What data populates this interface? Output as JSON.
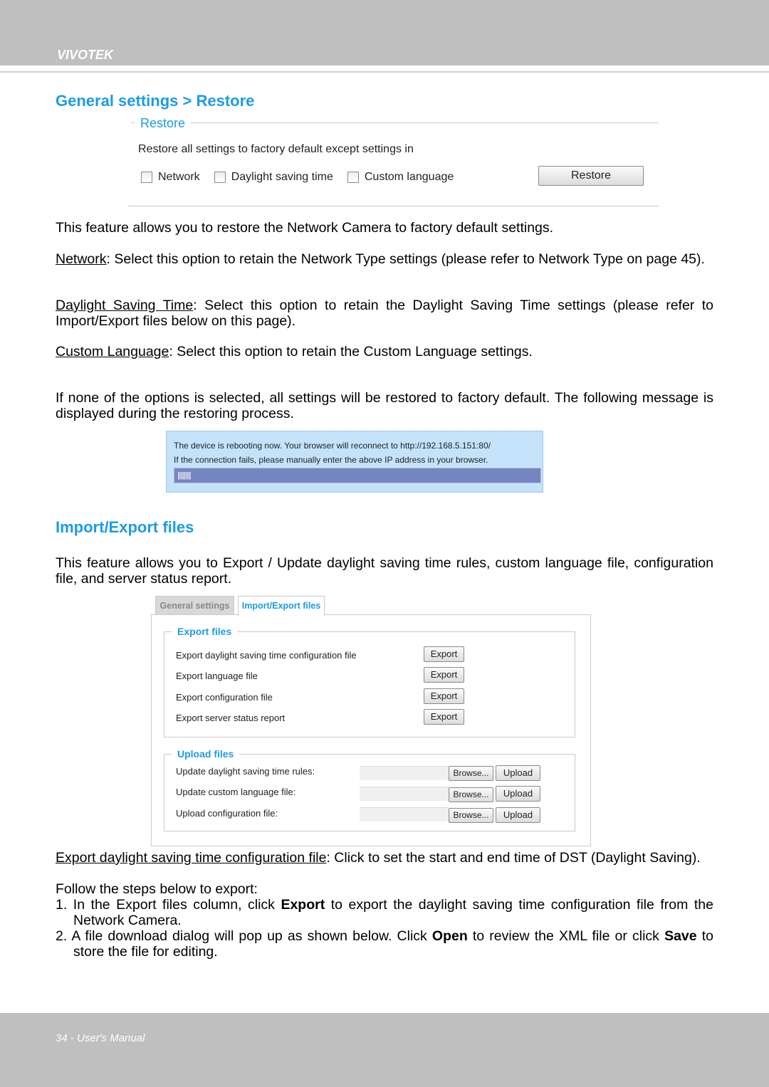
{
  "header": {
    "brand": "VIVOTEK"
  },
  "footer": {
    "page": "34 - User's Manual"
  },
  "section1": {
    "title": "General settings > Restore"
  },
  "restore_panel": {
    "legend": "Restore",
    "text": "Restore all settings to factory default except settings in",
    "options": [
      {
        "label": "Network",
        "checked": false
      },
      {
        "label": "Daylight saving time",
        "checked": false
      },
      {
        "label": "Custom language",
        "checked": false
      }
    ],
    "button": "Restore"
  },
  "paras": {
    "p1": "This feature allows you to restore the Network Camera to factory default settings.",
    "p2_term": "Network",
    "p2": ": Select this option to retain the Network Type settings (please refer to Network Type on page 45).",
    "p3_term": "Daylight Saving Time",
    "p3": ": Select this option to retain the Daylight Saving Time settings (please refer to Import/Export files below on this page).",
    "p4_term": "Custom Language",
    "p4": ": Select this option to retain the Custom Language settings.",
    "p5": "If none of the options is selected, all settings will be restored to factory default. The following message is displayed during the restoring process."
  },
  "reboot": {
    "line1": "The device is rebooting now. Your browser will reconnect to http://192.168.5.151:80/",
    "line2": "If the connection fails, please manually enter the above IP address in your browser.",
    "progress": "||||||||||"
  },
  "section2": {
    "title": "Import/Export files",
    "intro": "This feature allows you to Export / Update daylight saving time rules, custom language file, configuration file, and server status report."
  },
  "ie_panel": {
    "tabs": [
      {
        "label": "General settings",
        "active": false
      },
      {
        "label": "Import/Export files",
        "active": true
      }
    ],
    "export_legend": "Export files",
    "export_rows": [
      {
        "label": "Export daylight saving time configuration file",
        "button": "Export"
      },
      {
        "label": "Export language file",
        "button": "Export"
      },
      {
        "label": "Export configuration file",
        "button": "Export"
      },
      {
        "label": "Export server status report",
        "button": "Export"
      }
    ],
    "upload_legend": "Upload files",
    "upload_rows": [
      {
        "label": "Update daylight saving time rules:",
        "browse": "Browse...",
        "button": "Upload"
      },
      {
        "label": "Update custom language file:",
        "browse": "Browse...",
        "button": "Upload"
      },
      {
        "label": "Upload configuration file:",
        "browse": "Browse...",
        "button": "Upload"
      }
    ]
  },
  "after": {
    "p6_term": "Export daylight saving time configuration file",
    "p6": ": Click to set the start and end time of DST (Daylight Saving).",
    "p7": "Follow the steps below to export:",
    "s1a": "1. In the Export files column, click ",
    "s1b": "Export",
    "s1c": " to export the daylight saving time configuration file from the Network Camera.",
    "s2a": "2. A file download dialog will pop up as shown below. Click ",
    "s2b": "Open",
    "s2c": " to review the XML file or click ",
    "s2d": "Save",
    "s2e": " to store the file for editing."
  }
}
